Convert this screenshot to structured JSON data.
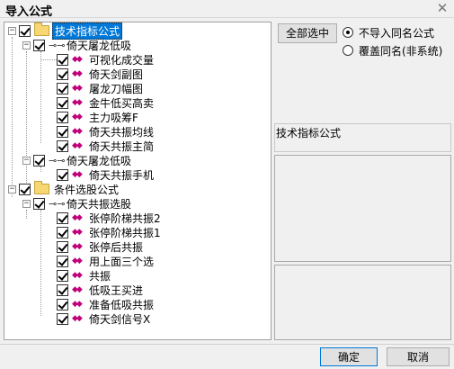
{
  "window": {
    "title": "导入公式",
    "close_glyph": "✕"
  },
  "tree": {
    "root1": "技术指标公式",
    "group1": "倚天屠龙低吸",
    "group1_items": [
      "可视化成交量",
      "倚天剑副图",
      "屠龙刀幅图",
      "金牛低买高卖",
      "主力吸筹F",
      "倚天共振均线",
      "倚天共振主简"
    ],
    "group2": "倚天屠龙低吸",
    "group2_items": [
      "倚天共振手机"
    ],
    "root2": "条件选股公式",
    "group3": "倚天共振选股",
    "group3_items": [
      "张停阶梯共振2",
      "张停阶梯共振1",
      "张停后共振",
      "用上面三个选",
      "共振",
      "低吸王买进",
      "准备低吸共振",
      "倚天剑信号X"
    ]
  },
  "controls": {
    "select_all": "全部选中",
    "radio_no_import": "不导入同名公式",
    "radio_overwrite": "覆盖同名(非系统)",
    "selected_radio": "radio_no_import"
  },
  "info": {
    "formula_type": "技术指标公式"
  },
  "footer": {
    "ok": "确定",
    "cancel": "取消"
  },
  "colors": {
    "selection": "#0078d7",
    "folder": "#f7d774",
    "formula_icon": "#c0007a"
  },
  "icons": {
    "root": "folder-icon",
    "group": "key-icon",
    "item": "formula-icon"
  }
}
